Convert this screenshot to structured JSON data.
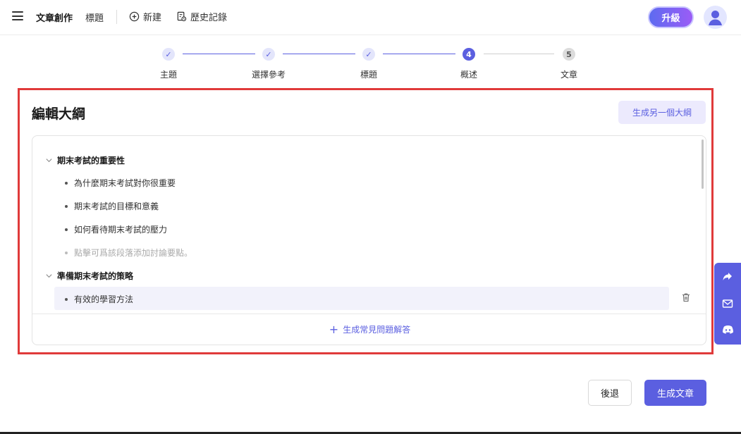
{
  "header": {
    "app_title": "文章創作",
    "breadcrumb": "標題",
    "new_label": "新建",
    "history_label": "歷史記錄",
    "upgrade_label": "升級"
  },
  "stepper": {
    "steps": [
      {
        "label": "主題",
        "marker": "✓",
        "state": "done"
      },
      {
        "label": "選擇參考",
        "marker": "✓",
        "state": "done"
      },
      {
        "label": "標題",
        "marker": "✓",
        "state": "done"
      },
      {
        "label": "概述",
        "marker": "4",
        "state": "active"
      },
      {
        "label": "文章",
        "marker": "5",
        "state": "todo"
      }
    ]
  },
  "outline": {
    "title": "編輯大綱",
    "regenerate_label": "生成另一個大綱",
    "sections": [
      {
        "heading": "期末考試的重要性",
        "points": [
          "為什麼期末考試對你很重要",
          "期末考試的目標和意義",
          "如何看待期末考試的壓力"
        ],
        "hint": "點擊可爲該段落添加討論要點。"
      },
      {
        "heading": "準備期末考試的策略",
        "points": [
          "有效的學習方法"
        ]
      }
    ],
    "faq_label": "生成常見問題解答"
  },
  "footer": {
    "back_label": "後退",
    "generate_label": "生成文章"
  },
  "colors": {
    "accent": "#5b5fe0",
    "highlight_border": "#e03a3a"
  },
  "icons": {
    "menu": "hamburger-icon",
    "new": "plus-circle-icon",
    "history": "history-doc-icon",
    "avatar": "user-avatar-icon",
    "share": "share-icon",
    "mail": "mail-icon",
    "discord": "discord-icon",
    "trash": "trash-icon"
  }
}
